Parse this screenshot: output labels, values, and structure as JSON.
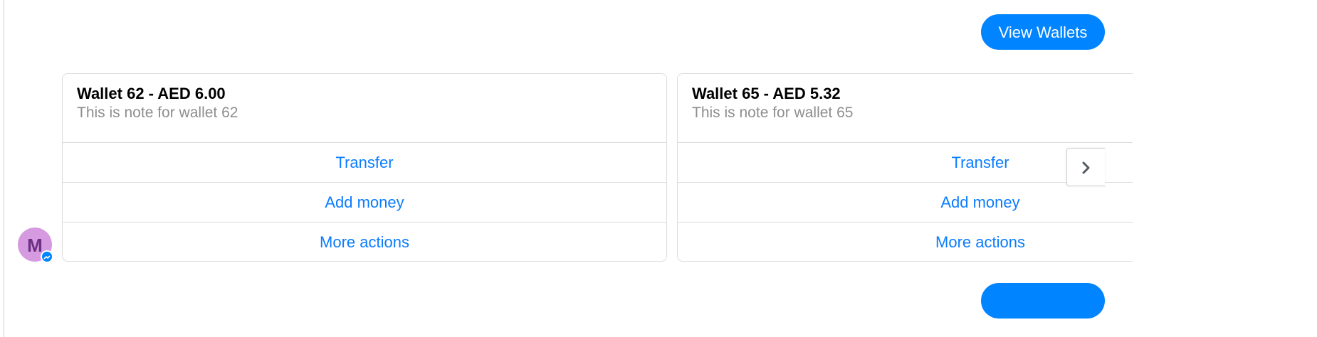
{
  "header": {
    "view_wallets_label": "View Wallets"
  },
  "cards": [
    {
      "title": "Wallet 62 - AED 6.00",
      "note": "This is note for wallet 62",
      "actions": [
        "Transfer",
        "Add money",
        "More actions"
      ]
    },
    {
      "title": "Wallet 65 - AED 5.32",
      "note": "This is note for wallet 65",
      "actions": [
        "Transfer",
        "Add money",
        "More actions"
      ]
    }
  ],
  "avatar": {
    "initial": "M",
    "background": "#d59ae0",
    "badge_icon": "messenger-icon"
  },
  "carousel": {
    "next_icon": "chevron-right-icon"
  },
  "colors": {
    "accent": "#0084ff",
    "action_text": "#0a7cff",
    "note_text": "#8e8e8e",
    "border": "#dcdcdc"
  }
}
